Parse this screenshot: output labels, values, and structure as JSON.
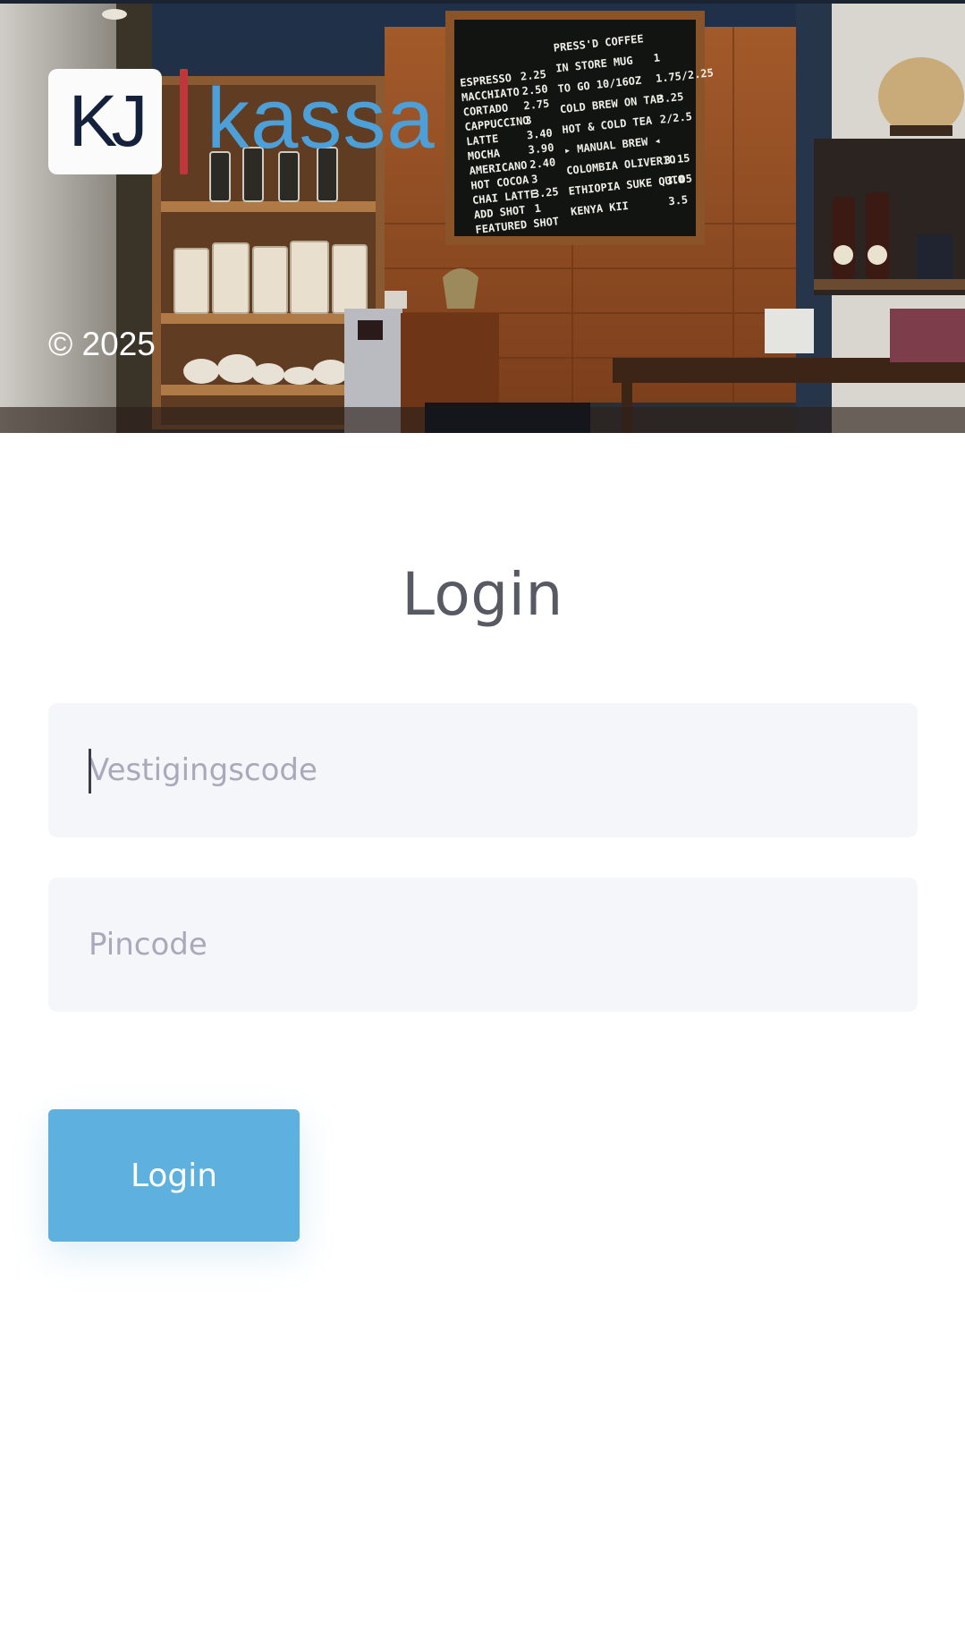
{
  "header": {
    "logo_mark": "KJ",
    "logo_word": "kassa",
    "copyright": "© 2025",
    "menu_board": {
      "left_items": [
        {
          "name": "ESPRESSO",
          "price": "2.25"
        },
        {
          "name": "MACCHIATO",
          "price": "2.50"
        },
        {
          "name": "CORTADO",
          "price": "2.75"
        },
        {
          "name": "CAPPUCCINO",
          "price": "3"
        },
        {
          "name": "LATTE",
          "price": "3.40"
        },
        {
          "name": "MOCHA",
          "price": "3.90"
        },
        {
          "name": "AMERICANO",
          "price": "2.40"
        },
        {
          "name": "HOT COCOA",
          "price": "3"
        },
        {
          "name": "CHAI LATTE",
          "price": "3.25"
        },
        {
          "name": "ADD SHOT",
          "price": "1"
        },
        {
          "name": "FEATURED SHOT",
          "price": ""
        }
      ],
      "right_items": [
        {
          "name": "PRESS'D COFFEE",
          "price": ""
        },
        {
          "name": "IN STORE MUG",
          "price": "1"
        },
        {
          "name": "TO GO 10/16OZ",
          "price": "1.75/2.25"
        },
        {
          "name": "COLD BREW ON TAP",
          "price": "3.25"
        },
        {
          "name": "HOT & COLD TEA",
          "price": "2/2.5"
        },
        {
          "name": "▸ MANUAL BREW ◂",
          "price": ""
        },
        {
          "name": "COLOMBIA OLIVERIO",
          "price": "3.15"
        },
        {
          "name": "ETHIOPIA SUKE QUTO",
          "price": "3.05"
        },
        {
          "name": "KENYA KII",
          "price": "3.5"
        }
      ]
    }
  },
  "login": {
    "title": "Login",
    "branch_code": {
      "value": "",
      "placeholder": "Vestigingscode"
    },
    "pincode": {
      "value": "",
      "placeholder": "Pincode"
    },
    "submit_label": "Login"
  },
  "colors": {
    "accent": "#5eb1de",
    "logo_navy": "#14213d",
    "logo_red": "#c0363a",
    "logo_blue": "#4d9fd8",
    "field_bg": "#f5f6f9",
    "title": "#575a63"
  },
  "icons": []
}
